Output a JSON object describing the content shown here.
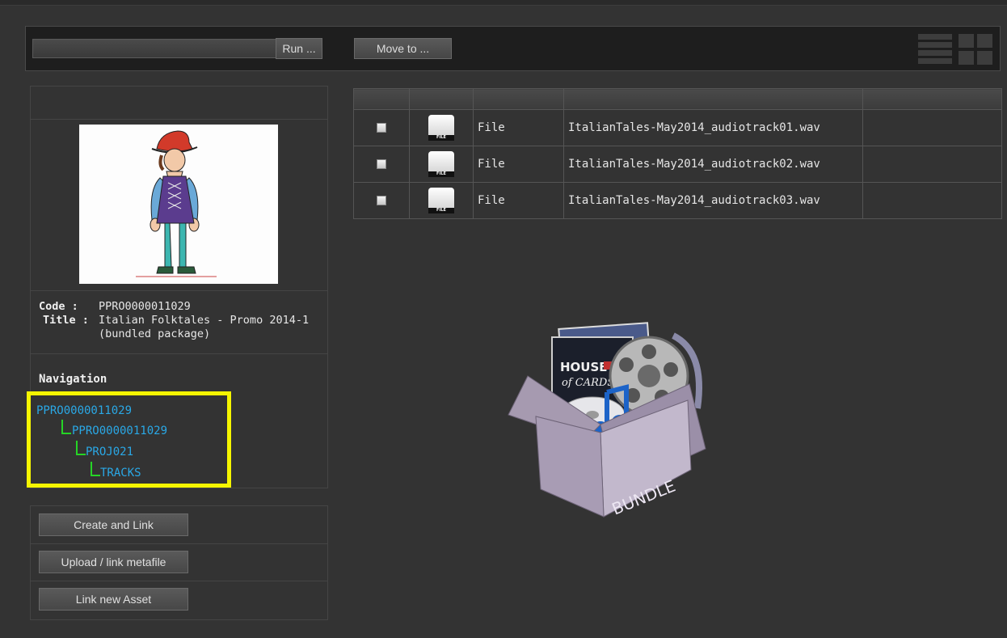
{
  "toolbar": {
    "select_value": "",
    "run_label": "Run ...",
    "move_label": "Move to ..."
  },
  "asset": {
    "code_key": "Code :",
    "code_value": "PPRO0000011029",
    "title_key": "Title :",
    "title_line1": "Italian Folktales - Promo 2014-1",
    "title_line2": "(bundled package)"
  },
  "navigation": {
    "title": "Navigation",
    "items": [
      {
        "label": "PPRO0000011029",
        "level": 0
      },
      {
        "label": "PPRO0000011029",
        "level": 1
      },
      {
        "label": "PROJ021",
        "level": 2
      },
      {
        "label": "TRACKS",
        "level": 3
      }
    ],
    "highlight_color": "#f5f500",
    "link_color": "#2aa8e6",
    "tree_line_color": "#26d426"
  },
  "actions": [
    {
      "label": "Create and Link"
    },
    {
      "label": "Upload / link metafile"
    },
    {
      "label": "Link new Asset"
    }
  ],
  "files": [
    {
      "icon_text": "FILE",
      "type": "File",
      "name": "ItalianTales-May2014_audiotrack01.wav",
      "checked": false
    },
    {
      "icon_text": "FILE",
      "type": "File",
      "name": "ItalianTales-May2014_audiotrack02.wav",
      "checked": false
    },
    {
      "icon_text": "FILE",
      "type": "File",
      "name": "ItalianTales-May2014_audiotrack03.wav",
      "checked": false
    }
  ],
  "bundle": {
    "box_label": "BUNDLE",
    "poster_line1": "HOUSE",
    "poster_line2": "of CARDS"
  },
  "icons": {
    "view_list": "list-view-icon",
    "view_grid": "grid-view-icon",
    "file": "file-icon",
    "bundle": "bundle-box-icon"
  }
}
